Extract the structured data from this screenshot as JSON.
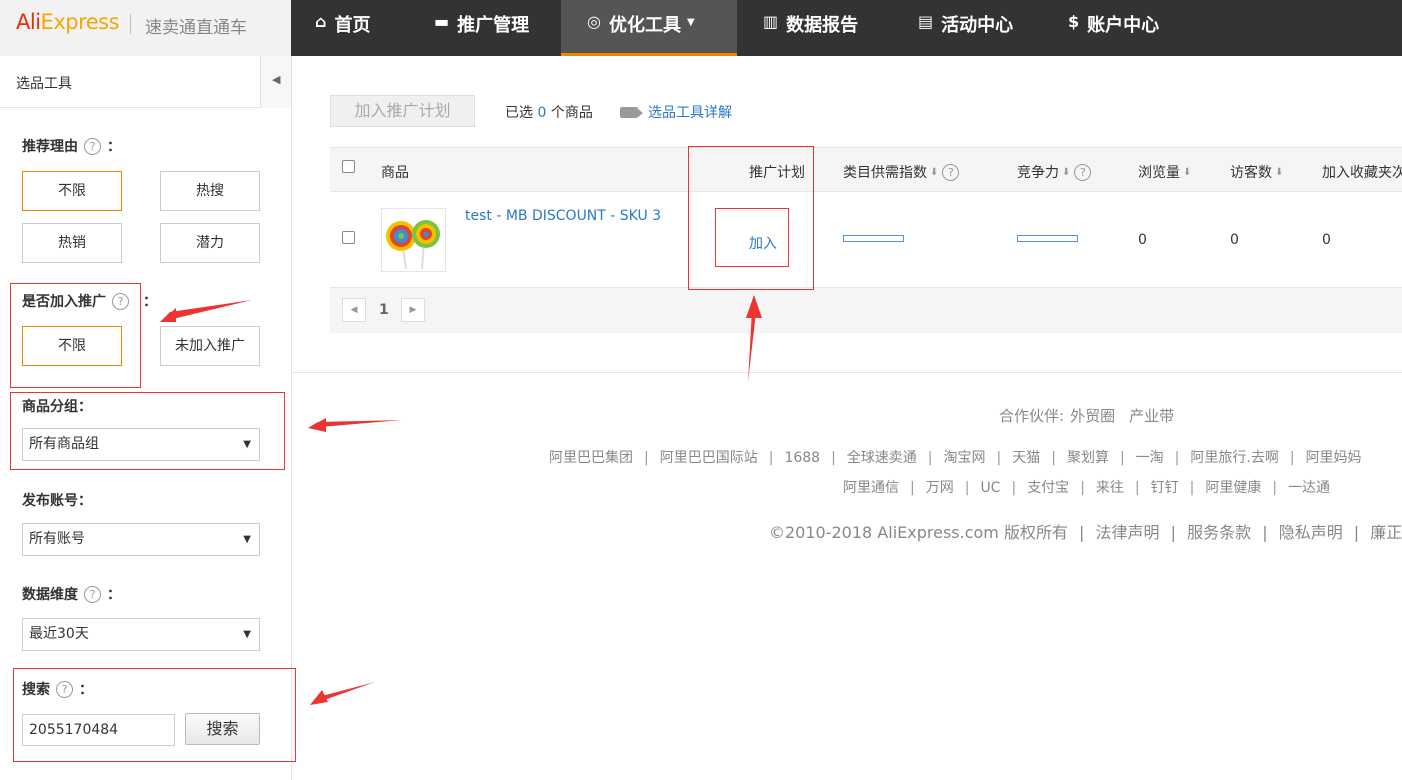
{
  "header": {
    "logo_brand_a": "Ali",
    "logo_brand_b": "Express",
    "logo_subtitle": "速卖通直通车",
    "nav": [
      {
        "label": "首页",
        "icon": "home-icon",
        "glyph": "⌂"
      },
      {
        "label": "推广管理",
        "icon": "briefcase-icon",
        "glyph": "▬"
      },
      {
        "label": "优化工具",
        "icon": "search-optimize-icon",
        "glyph": "◎",
        "caret": "▼"
      },
      {
        "label": "数据报告",
        "icon": "bar-chart-icon",
        "glyph": "▥"
      },
      {
        "label": "活动中心",
        "icon": "document-edit-icon",
        "glyph": "▤"
      },
      {
        "label": "账户中心",
        "icon": "dollar-icon",
        "glyph": "$"
      }
    ]
  },
  "sidebar": {
    "title": "选品工具",
    "collapse_glyph": "◀",
    "reason": {
      "label": "推荐理由",
      "help": "?",
      "colon": "：",
      "options": [
        "不限",
        "热搜",
        "热销",
        "潜力"
      ]
    },
    "promo": {
      "label": "是否加入推广",
      "help": "?",
      "colon": "：",
      "options": [
        "不限",
        "未加入推广"
      ]
    },
    "group": {
      "label": "商品分组：",
      "value": "所有商品组"
    },
    "account": {
      "label": "发布账号：",
      "value": "所有账号"
    },
    "dimension": {
      "label": "数据维度",
      "help": "?",
      "colon": "：",
      "value": "最近30天"
    },
    "search": {
      "label": "搜索",
      "help": "?",
      "colon": "：",
      "value": "2055170484",
      "button": "搜索"
    },
    "select_arrow": "▼"
  },
  "main": {
    "add_button": "加入推广计划",
    "selected_prefix": "已选",
    "selected_count": "0",
    "selected_suffix": "个商品",
    "tool_link": "选品工具详解",
    "columns": {
      "product": "商品",
      "plan": "推广计划",
      "supply": "类目供需指数",
      "compete": "竞争力",
      "views": "浏览量",
      "visitors": "访客数",
      "favorites": "加入收藏夹次"
    },
    "sort_glyph": "⬇",
    "help": "?",
    "row": {
      "name": "test - MB DISCOUNT - SKU 3",
      "plan_action": "加入",
      "supply_level": 0.0,
      "compete_level": 0.0,
      "views": "0",
      "visitors": "0",
      "favorites": "0"
    },
    "pager": {
      "prev": "◀",
      "page": "1",
      "next": "▶"
    }
  },
  "footer": {
    "partner_label": "合作伙伴:",
    "partners": [
      "外贸圈",
      "产业带"
    ],
    "links_row1": [
      "阿里巴巴集团",
      "阿里巴巴国际站",
      "1688",
      "全球速卖通",
      "淘宝网",
      "天猫",
      "聚划算",
      "一淘",
      "阿里旅行.去啊",
      "阿里妈妈"
    ],
    "links_row2": [
      "阿里通信",
      "万网",
      "UC",
      "支付宝",
      "来往",
      "钉钉",
      "阿里健康",
      "一达通"
    ],
    "copyright": "©2010-2018 AliExpress.com 版权所有",
    "legal_links": [
      "法律声明",
      "服务条款",
      "隐私声明",
      "廉正举报"
    ]
  },
  "colors": {
    "accent": "#f08300",
    "link": "#2a79c5",
    "annotation": "#e33333",
    "topbar": "#333333"
  }
}
